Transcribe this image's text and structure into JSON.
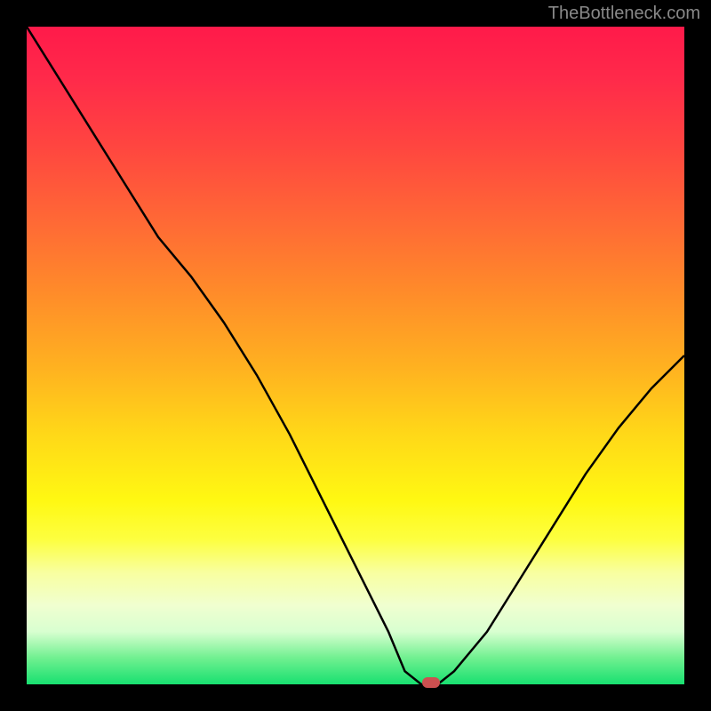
{
  "watermark": "TheBottleneck.com",
  "chart_data": {
    "type": "line",
    "title": "",
    "xlabel": "",
    "ylabel": "",
    "x": [
      0.0,
      0.05,
      0.1,
      0.15,
      0.2,
      0.25,
      0.3,
      0.35,
      0.4,
      0.45,
      0.5,
      0.55,
      0.575,
      0.6,
      0.625,
      0.65,
      0.7,
      0.75,
      0.8,
      0.85,
      0.9,
      0.95,
      1.0
    ],
    "values": [
      100,
      92,
      84,
      76,
      68,
      62,
      55,
      47,
      38,
      28,
      18,
      8,
      2,
      0,
      0,
      2,
      8,
      16,
      24,
      32,
      39,
      45,
      50
    ],
    "ylim": [
      0,
      100
    ],
    "xlim": [
      0,
      1
    ],
    "marker": {
      "x": 0.615,
      "y": 0
    },
    "gradient": {
      "top_color": "#ff1a4a",
      "mid_color": "#ffd818",
      "bottom_color": "#18e070"
    }
  }
}
